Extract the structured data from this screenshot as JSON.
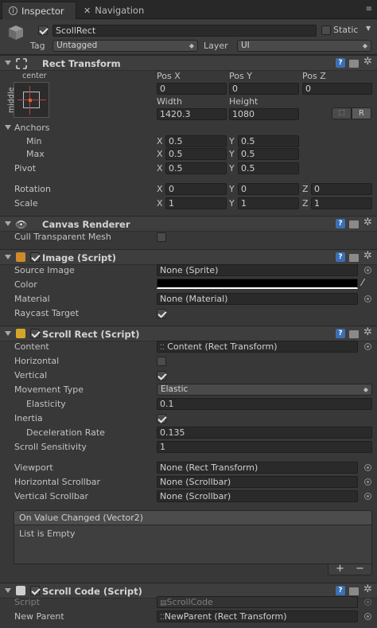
{
  "tabs": {
    "inspector": "Inspector",
    "navigation": "Navigation"
  },
  "gameobject": {
    "name": "ScollRect",
    "static_label": "Static",
    "tag_label": "Tag",
    "tag_value": "Untagged",
    "layer_label": "Layer",
    "layer_value": "UI"
  },
  "rect_transform": {
    "title": "Rect Transform",
    "anchor_h": "center",
    "anchor_v": "middle",
    "pos_x_label": "Pos X",
    "pos_y_label": "Pos Y",
    "pos_z_label": "Pos Z",
    "pos_x": "0",
    "pos_y": "0",
    "pos_z": "0",
    "width_label": "Width",
    "height_label": "Height",
    "width": "1420.3",
    "height": "1080",
    "blueprint_btn": "⬚",
    "raw_btn": "R",
    "anchors_label": "Anchors",
    "min_label": "Min",
    "max_label": "Max",
    "pivot_label": "Pivot",
    "x": "X",
    "y": "Y",
    "z": "Z",
    "min_x": "0.5",
    "min_y": "0.5",
    "max_x": "0.5",
    "max_y": "0.5",
    "pivot_x": "0.5",
    "pivot_y": "0.5",
    "rotation_label": "Rotation",
    "rot_x": "0",
    "rot_y": "0",
    "rot_z": "0",
    "scale_label": "Scale",
    "scale_x": "1",
    "scale_y": "1",
    "scale_z": "1"
  },
  "canvas_renderer": {
    "title": "Canvas Renderer",
    "cull_label": "Cull Transparent Mesh"
  },
  "image": {
    "title": "Image (Script)",
    "source_label": "Source Image",
    "source_value": "None (Sprite)",
    "color_label": "Color",
    "color_value": "#000000",
    "material_label": "Material",
    "material_value": "None (Material)",
    "raycast_label": "Raycast Target"
  },
  "scroll_rect": {
    "title": "Scroll Rect (Script)",
    "content_label": "Content",
    "content_value": "Content (Rect Transform)",
    "horizontal_label": "Horizontal",
    "vertical_label": "Vertical",
    "movement_label": "Movement Type",
    "movement_value": "Elastic",
    "elasticity_label": "Elasticity",
    "elasticity_value": "0.1",
    "inertia_label": "Inertia",
    "deceleration_label": "Deceleration Rate",
    "deceleration_value": "0.135",
    "sensitivity_label": "Scroll Sensitivity",
    "sensitivity_value": "1",
    "viewport_label": "Viewport",
    "viewport_value": "None (Rect Transform)",
    "hscroll_label": "Horizontal Scrollbar",
    "hscroll_value": "None (Scrollbar)",
    "vscroll_label": "Vertical Scrollbar",
    "vscroll_value": "None (Scrollbar)",
    "event_title": "On Value Changed (Vector2)",
    "event_empty": "List is Empty",
    "add_btn": "+",
    "remove_btn": "−"
  },
  "scroll_code": {
    "title": "Scroll Code (Script)",
    "script_label": "Script",
    "script_value": "ScrollCode",
    "parent_label": "New Parent",
    "parent_value": "NewParent (Rect Transform)"
  }
}
